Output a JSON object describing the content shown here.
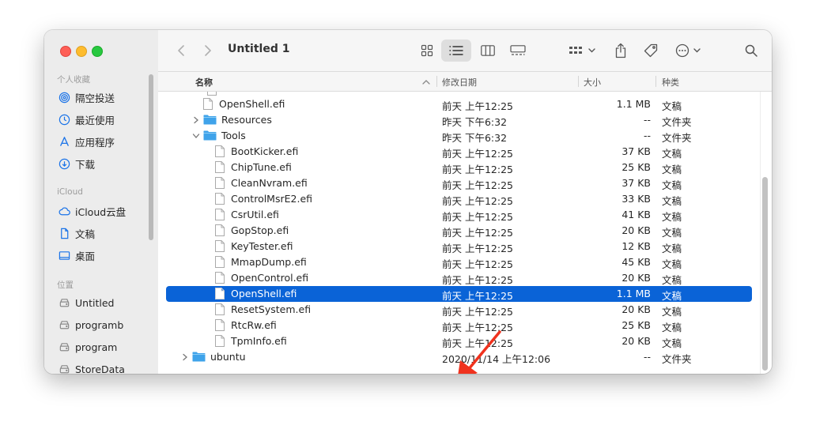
{
  "window": {
    "title": "Untitled 1"
  },
  "sidebar": {
    "sections": [
      {
        "label": "个人收藏"
      },
      {
        "label": "iCloud"
      },
      {
        "label": "位置"
      }
    ],
    "items": [
      {
        "label": "隔空投送",
        "icon": "airdrop-icon"
      },
      {
        "label": "最近使用",
        "icon": "clock-icon"
      },
      {
        "label": "应用程序",
        "icon": "applications-icon"
      },
      {
        "label": "下载",
        "icon": "download-icon"
      },
      {
        "label": "iCloud云盘",
        "icon": "cloud-icon"
      },
      {
        "label": "文稿",
        "icon": "document-icon"
      },
      {
        "label": "桌面",
        "icon": "desktop-icon"
      },
      {
        "label": "Untitled",
        "icon": "disk-icon"
      },
      {
        "label": "programb",
        "icon": "disk-icon"
      },
      {
        "label": "program",
        "icon": "disk-icon"
      },
      {
        "label": "StoreData",
        "icon": "disk-icon"
      }
    ]
  },
  "columns": {
    "name": "名称",
    "date": "修改日期",
    "size": "大小",
    "kind": "种类"
  },
  "rows": [
    {
      "name": "OpenShell.efi",
      "date": "前天 上午12:25",
      "size": "1.1 MB",
      "kind": "文稿"
    },
    {
      "name": "Resources",
      "date": "昨天 下午6:32",
      "size": "--",
      "kind": "文件夹"
    },
    {
      "name": "Tools",
      "date": "昨天 下午6:32",
      "size": "--",
      "kind": "文件夹"
    },
    {
      "name": "BootKicker.efi",
      "date": "前天 上午12:25",
      "size": "37 KB",
      "kind": "文稿"
    },
    {
      "name": "ChipTune.efi",
      "date": "前天 上午12:25",
      "size": "25 KB",
      "kind": "文稿"
    },
    {
      "name": "CleanNvram.efi",
      "date": "前天 上午12:25",
      "size": "37 KB",
      "kind": "文稿"
    },
    {
      "name": "ControlMsrE2.efi",
      "date": "前天 上午12:25",
      "size": "33 KB",
      "kind": "文稿"
    },
    {
      "name": "CsrUtil.efi",
      "date": "前天 上午12:25",
      "size": "41 KB",
      "kind": "文稿"
    },
    {
      "name": "GopStop.efi",
      "date": "前天 上午12:25",
      "size": "20 KB",
      "kind": "文稿"
    },
    {
      "name": "KeyTester.efi",
      "date": "前天 上午12:25",
      "size": "12 KB",
      "kind": "文稿"
    },
    {
      "name": "MmapDump.efi",
      "date": "前天 上午12:25",
      "size": "45 KB",
      "kind": "文稿"
    },
    {
      "name": "OpenControl.efi",
      "date": "前天 上午12:25",
      "size": "20 KB",
      "kind": "文稿"
    },
    {
      "name": "OpenShell.efi",
      "date": "前天 上午12:25",
      "size": "1.1 MB",
      "kind": "文稿"
    },
    {
      "name": "ResetSystem.efi",
      "date": "前天 上午12:25",
      "size": "20 KB",
      "kind": "文稿"
    },
    {
      "name": "RtcRw.efi",
      "date": "前天 上午12:25",
      "size": "25 KB",
      "kind": "文稿"
    },
    {
      "name": "TpmInfo.efi",
      "date": "前天 上午12:25",
      "size": "20 KB",
      "kind": "文稿"
    },
    {
      "name": "ubuntu",
      "date": "2020/11/14 上午12:06",
      "size": "--",
      "kind": "文件夹"
    }
  ],
  "colors": {
    "accent": "#0a63d7",
    "annotation_arrow": "#f0321e",
    "folder": "#3fa3ea"
  }
}
